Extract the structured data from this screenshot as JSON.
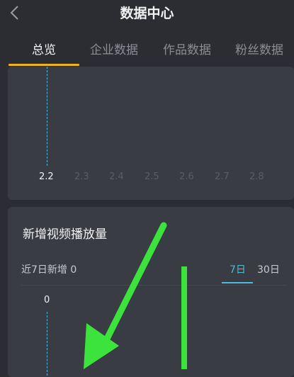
{
  "header": {
    "title": "数据中心",
    "back_icon": "chevron-left-icon"
  },
  "tabs": [
    {
      "label": "总览",
      "active": true
    },
    {
      "label": "企业数据",
      "active": false
    },
    {
      "label": "作品数据",
      "active": false
    },
    {
      "label": "粉丝数据",
      "active": false
    }
  ],
  "top_chart": {
    "x_ticks": [
      "2.2",
      "2.3",
      "2.4",
      "2.5",
      "2.6",
      "2.7",
      "2.8"
    ],
    "selected_tick": "2.2"
  },
  "video_plays": {
    "title": "新增视频播放量",
    "summary": "近7日新增 0",
    "ranges": [
      {
        "label": "7日",
        "active": true
      },
      {
        "label": "30日",
        "active": false
      }
    ],
    "selected_value": "0"
  },
  "colors": {
    "background": "#2b2d33",
    "card": "#3a3c43",
    "accent_tab": "#f0b31c",
    "accent_range": "#4bbbe0",
    "annotation": "#3de33d"
  }
}
